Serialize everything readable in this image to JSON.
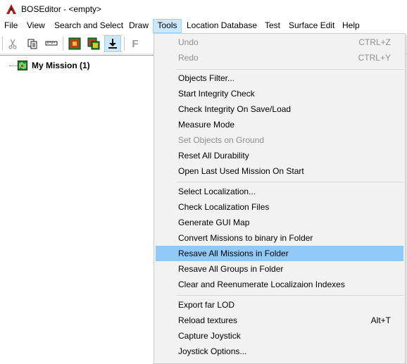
{
  "window": {
    "title": "BOSEditor - <empty>"
  },
  "menubar": {
    "items": [
      "File",
      "View",
      "Search and Select",
      "Draw",
      "Tools",
      "Location Database",
      "Test",
      "Surface Edit",
      "Help"
    ]
  },
  "toolbar": {
    "buttons": [
      "cut-icon",
      "copy-icon",
      "paste-icon",
      "map-icon",
      "layers-icon",
      "download-icon",
      "text-icon"
    ],
    "text_button_label": "F"
  },
  "tree": {
    "root_label": "My Mission (1)"
  },
  "tools_menu": {
    "groups": [
      [
        {
          "label": "Undo",
          "shortcut": "CTRL+Z",
          "disabled": true
        },
        {
          "label": "Redo",
          "shortcut": "CTRL+Y",
          "disabled": true
        }
      ],
      [
        {
          "label": "Objects Filter...",
          "shortcut": "",
          "disabled": false
        },
        {
          "label": "Start Integrity Check",
          "shortcut": "",
          "disabled": false
        },
        {
          "label": "Check Integrity On Save/Load",
          "shortcut": "",
          "disabled": false
        },
        {
          "label": "Measure Mode",
          "shortcut": "",
          "disabled": false
        },
        {
          "label": "Set Objects on Ground",
          "shortcut": "",
          "disabled": true
        },
        {
          "label": "Reset All Durability",
          "shortcut": "",
          "disabled": false
        },
        {
          "label": "Open Last Used Mission On Start",
          "shortcut": "",
          "disabled": false
        }
      ],
      [
        {
          "label": "Select Localization...",
          "shortcut": "",
          "disabled": false
        },
        {
          "label": "Check Localization Files",
          "shortcut": "",
          "disabled": false
        },
        {
          "label": "Generate GUI Map",
          "shortcut": "",
          "disabled": false
        },
        {
          "label": "Convert Missions to binary in Folder",
          "shortcut": "",
          "disabled": false
        },
        {
          "label": "Resave All Missions in Folder",
          "shortcut": "",
          "disabled": false,
          "highlighted": true
        },
        {
          "label": "Resave All Groups in Folder",
          "shortcut": "",
          "disabled": false
        },
        {
          "label": "Clear and Reenumerate Localizaion Indexes",
          "shortcut": "",
          "disabled": false
        }
      ],
      [
        {
          "label": "Export far LOD",
          "shortcut": "",
          "disabled": false
        },
        {
          "label": "Reload textures",
          "shortcut": "Alt+T",
          "disabled": false
        },
        {
          "label": "Capture Joystick",
          "shortcut": "",
          "disabled": false
        },
        {
          "label": "Joystick Options...",
          "shortcut": "",
          "disabled": false
        }
      ]
    ]
  },
  "colors": {
    "menu_active_bg": "#cce8ff",
    "dropdown_bg": "#f2f2f2",
    "highlight_bg": "#91c9f7",
    "disabled_text": "#8f8f8f"
  }
}
